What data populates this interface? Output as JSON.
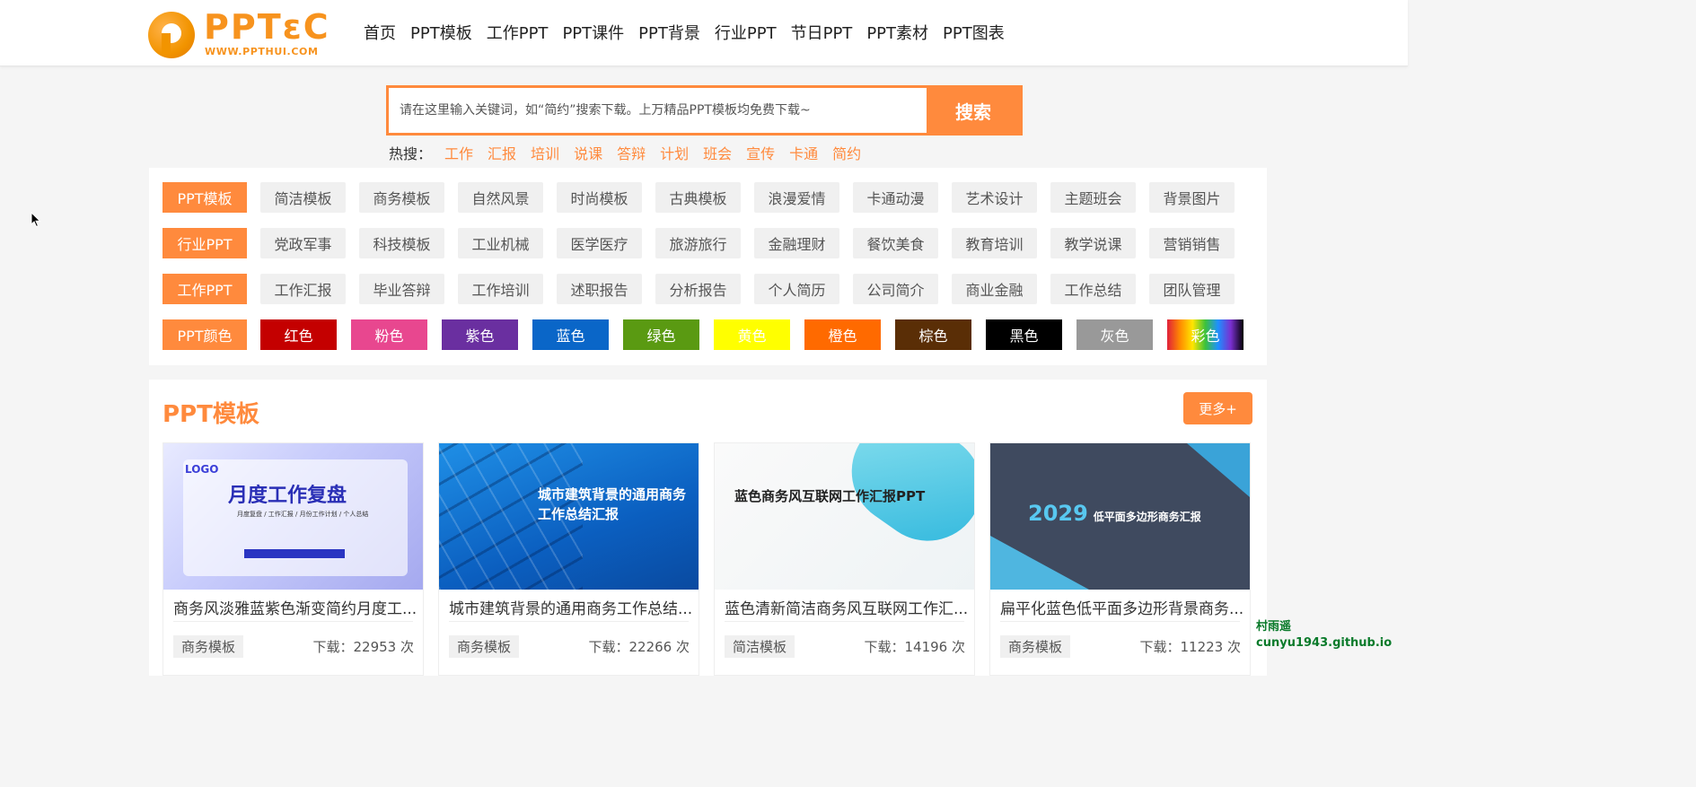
{
  "brand": {
    "logo_text": "PPTɛC",
    "logo_sub": "WWW.PPTHUI.COM",
    "accent": "#ff8a3d"
  },
  "nav": [
    "首页",
    "PPT模板",
    "工作PPT",
    "PPT课件",
    "PPT背景",
    "行业PPT",
    "节日PPT",
    "PPT素材",
    "PPT图表"
  ],
  "search": {
    "placeholder": "请在这里输入关键词，如“简约”搜索下载。上万精品PPT模板均免费下载~",
    "button": "搜索"
  },
  "hot": {
    "label": "热搜：",
    "terms": [
      "工作",
      "汇报",
      "培训",
      "说课",
      "答辩",
      "计划",
      "班会",
      "宣传",
      "卡通",
      "简约"
    ]
  },
  "categories": [
    {
      "head": "PPT模板",
      "items": [
        "简洁模板",
        "商务模板",
        "自然风景",
        "时尚模板",
        "古典模板",
        "浪漫爱情",
        "卡通动漫",
        "艺术设计",
        "主题班会",
        "背景图片"
      ]
    },
    {
      "head": "行业PPT",
      "items": [
        "党政军事",
        "科技模板",
        "工业机械",
        "医学医疗",
        "旅游旅行",
        "金融理财",
        "餐饮美食",
        "教育培训",
        "教学说课",
        "营销销售"
      ]
    },
    {
      "head": "工作PPT",
      "items": [
        "工作汇报",
        "毕业答辩",
        "工作培训",
        "述职报告",
        "分析报告",
        "个人简历",
        "公司简介",
        "商业金融",
        "工作总结",
        "团队管理"
      ]
    }
  ],
  "colors": {
    "head": "PPT颜色",
    "items": [
      {
        "label": "红色",
        "color": "#c40000"
      },
      {
        "label": "粉色",
        "color": "#e8478f"
      },
      {
        "label": "紫色",
        "color": "#6a2fa0"
      },
      {
        "label": "蓝色",
        "color": "#0a66c8"
      },
      {
        "label": "绿色",
        "color": "#5a9a12"
      },
      {
        "label": "黄色",
        "color": "#ffff00"
      },
      {
        "label": "橙色",
        "color": "#ff6a00"
      },
      {
        "label": "棕色",
        "color": "#5a2e06"
      },
      {
        "label": "黑色",
        "color": "#000000"
      },
      {
        "label": "灰色",
        "color": "#999999"
      },
      {
        "label": "彩色",
        "color": "rainbow"
      }
    ]
  },
  "section": {
    "title": "PPT模板",
    "more": "更多+",
    "cards": [
      {
        "title": "商务风淡雅蓝紫色渐变简约月度工...",
        "tag": "商务模板",
        "downloads": "下载：22953 次",
        "thumb_text": "月度工作复盘",
        "thumb_logo": "LOGO",
        "thumb_sub": "月度复盘 / 工作汇报 / 月份工作计划 / 个人总结"
      },
      {
        "title": "城市建筑背景的通用商务工作总结...",
        "tag": "商务模板",
        "downloads": "下载：22266 次",
        "thumb_text": "城市建筑背景的通用商务工作总结汇报"
      },
      {
        "title": "蓝色清新简洁商务风互联网工作汇...",
        "tag": "简洁模板",
        "downloads": "下载：14196 次",
        "thumb_text": "蓝色商务风互联网工作汇报PPT"
      },
      {
        "title": "扁平化蓝色低平面多边形背景商务...",
        "tag": "商务模板",
        "downloads": "下载：11223 次",
        "thumb_year": "2029",
        "thumb_text": "低平面多边形商务汇报"
      }
    ]
  },
  "watermark": {
    "line1": "村雨遥",
    "line2": "cunyu1943.github.io"
  }
}
